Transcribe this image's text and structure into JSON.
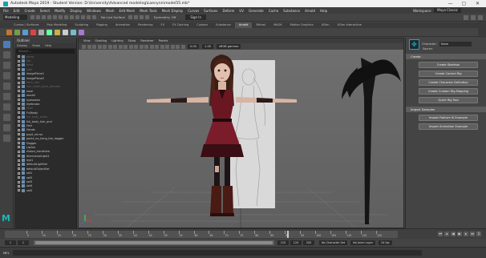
{
  "window": {
    "title": "Autodesk Maya 2019 - Student Version: D:\\University\\Advanced modeling\\Laenynn\\model55.mb*",
    "controls": [
      "—",
      "▢",
      "✕"
    ]
  },
  "menubar": {
    "items": [
      "File",
      "Edit",
      "Create",
      "Select",
      "Modify",
      "Display",
      "Windows",
      "Mesh",
      "Edit Mesh",
      "Mesh Tools",
      "Mesh Display",
      "Curves",
      "Surfaces",
      "Deform",
      "UV",
      "Generate",
      "Cache",
      "Substance",
      "Arnold",
      "Help"
    ],
    "workspace_label": "Workspace:",
    "workspace_value": "Maya Classic"
  },
  "statusline": {
    "mode": "Modeling",
    "no_live_surface": "No Live Surface",
    "symmetry": "Symmetry: Off",
    "sign_in": "Sign In"
  },
  "shelf": {
    "tabs": [
      "Curves / Surfaces",
      "Poly Modeling",
      "Sculpting",
      "Rigging",
      "Animation",
      "Rendering",
      "FX",
      "FX Caching",
      "Custom",
      "Substance",
      "Arnold",
      "Bifrost",
      "MASH",
      "Motion Graphics",
      "XGen",
      "XGen Interactive"
    ],
    "active_tab": "Arnold",
    "icon_colors": [
      "#c2772f",
      "#7a9a4b",
      "#5a9bd2",
      "#d44",
      "#aaa",
      "#6fa",
      "#c7b14a",
      "#ccc",
      "#7bc",
      "#a7c",
      "#d98",
      "#9c7",
      "#5a9bd2",
      "#c2772f",
      "#aaa",
      "#7a9a4b"
    ]
  },
  "outliner": {
    "title": "Outliner",
    "menu": [
      "Display",
      "Show",
      "Help"
    ],
    "search_placeholder": "Search...",
    "items": [
      {
        "label": "persp",
        "dim": true
      },
      {
        "label": "top",
        "dim": true
      },
      {
        "label": "front",
        "dim": true
      },
      {
        "label": "side",
        "dim": true
      },
      {
        "label": "imagePlane1",
        "dim": false
      },
      {
        "label": "imagePlane2",
        "dim": false
      },
      {
        "label": "back_hair",
        "dim": true
      },
      {
        "label": "hair_mesh_back_strands",
        "dim": true
      },
      {
        "label": "nose",
        "dim": false
      },
      {
        "label": "mouth",
        "dim": false
      },
      {
        "label": "eyelashes",
        "dim": false
      },
      {
        "label": "eyebrows",
        "dim": false
      },
      {
        "label": "shoe",
        "dim": true
      },
      {
        "label": "Fullbody",
        "dim": false
      },
      {
        "label": "full_body_dress",
        "dim": true
      },
      {
        "label": "full_body_hair_and",
        "dim": false
      },
      {
        "label": "Hair",
        "dim": false
      },
      {
        "label": "Hands",
        "dim": false
      },
      {
        "label": "pupil_mirror",
        "dim": false
      },
      {
        "label": "pants_no_hang_the_dagger",
        "dim": false
      },
      {
        "label": "Dagger",
        "dim": false
      },
      {
        "label": "Lipline",
        "dim": false
      },
      {
        "label": "ribbon_transform",
        "dim": false
      },
      {
        "label": "directionalLight1",
        "dim": false
      },
      {
        "label": "eye1",
        "dim": false
      },
      {
        "label": "defaultLightSet",
        "dim": false
      },
      {
        "label": "defaultObjectSet",
        "dim": false
      },
      {
        "label": "set1",
        "dim": false
      },
      {
        "label": "set2",
        "dim": false
      },
      {
        "label": "set3",
        "dim": false
      },
      {
        "label": "set4",
        "dim": false
      },
      {
        "label": "set5",
        "dim": false
      }
    ]
  },
  "viewport": {
    "menu": [
      "View",
      "Shading",
      "Lighting",
      "Show",
      "Renderer",
      "Panels"
    ],
    "field1": "0.00",
    "field2": "1.00",
    "colorspace": "sRGB gamma"
  },
  "toolbox": {
    "logo": "M"
  },
  "rightpanel": {
    "character_label": "Character:",
    "character_value": "None",
    "source_label": "Source:",
    "sections": [
      {
        "title": "Create",
        "buttons": [
          "Create Skeleton",
          "Create Control Rig",
          "Create Character Definition",
          "Create Custom Rig Mapping",
          "Quick Rig Tool"
        ]
      },
      {
        "title": "Import Samples",
        "buttons": [
          "Import Feature IK Example",
          "Import Animation Example"
        ]
      }
    ]
  },
  "timeslider": {
    "labels": [
      "5",
      "10",
      "15",
      "20",
      "25",
      "30",
      "35",
      "40",
      "45",
      "50",
      "55",
      "60",
      "65",
      "70",
      "75",
      "80",
      "85",
      "90",
      "95",
      "100",
      "105",
      "110",
      "115",
      "120"
    ],
    "current_frame": "1"
  },
  "rangeslider": {
    "start": "1",
    "inner_start": "1",
    "inner_end": "120",
    "end": "120",
    "end2": "200",
    "character_set": "No Character Set",
    "anim_layer": "No Anim Layer",
    "fps": "24 fps"
  },
  "cmdline": {
    "label": "MEL"
  }
}
